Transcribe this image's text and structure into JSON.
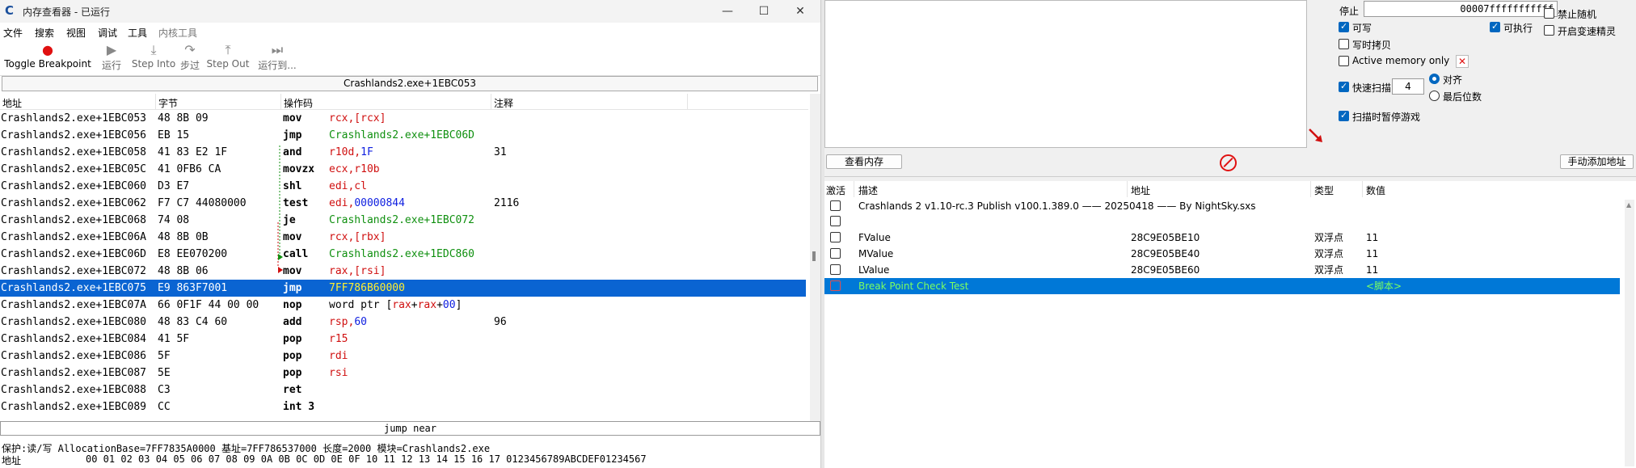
{
  "window": {
    "title": "内存查看器 - 已运行",
    "logo": "C",
    "min": "—",
    "max": "☐",
    "close": "✕"
  },
  "menu": [
    "文件",
    "搜索",
    "视图",
    "调试",
    "工具",
    "内核工具"
  ],
  "toolbar": [
    {
      "label": "Toggle Breakpoint",
      "icon": "●",
      "icon_name": "breakpoint-icon"
    },
    {
      "label": "运行",
      "icon": "▶",
      "icon_name": "run-icon"
    },
    {
      "label": "Step Into",
      "icon": "⤓",
      "icon_name": "step-into-icon"
    },
    {
      "label": "步过",
      "icon": "↷",
      "icon_name": "step-over-icon"
    },
    {
      "label": "Step Out",
      "icon": "⤒",
      "icon_name": "step-out-icon"
    },
    {
      "label": "运行到...",
      "icon": "⏭",
      "icon_name": "run-to-icon"
    }
  ],
  "address_bar": "Crashlands2.exe+1EBC053",
  "disasm_headers": {
    "addr": "地址",
    "bytes": "字节",
    "opcode": "操作码",
    "comment": "注释"
  },
  "disasm_rows": [
    {
      "addr": "Crashlands2.exe+1EBC053",
      "bytes": "48 8B 09",
      "op": "mov",
      "args": [
        [
          "rcx,[rcx]",
          "red"
        ]
      ],
      "comment": ""
    },
    {
      "addr": "Crashlands2.exe+1EBC056",
      "bytes": "EB 15",
      "op": "jmp",
      "args": [
        [
          "Crashlands2.exe+1EBC06D",
          "grn"
        ]
      ],
      "comment": ""
    },
    {
      "addr": "Crashlands2.exe+1EBC058",
      "bytes": "41 83 E2 1F",
      "op": "and",
      "args": [
        [
          "r10d,",
          "red"
        ],
        [
          "1F",
          "blu"
        ]
      ],
      "comment": "31"
    },
    {
      "addr": "Crashlands2.exe+1EBC05C",
      "bytes": "41 0FB6 CA",
      "op": "movzx",
      "args": [
        [
          "ecx,r10b",
          "red"
        ]
      ],
      "comment": ""
    },
    {
      "addr": "Crashlands2.exe+1EBC060",
      "bytes": "D3 E7",
      "op": "shl",
      "args": [
        [
          "edi,cl",
          "red"
        ]
      ],
      "comment": ""
    },
    {
      "addr": "Crashlands2.exe+1EBC062",
      "bytes": "F7 C7 44080000",
      "op": "test",
      "args": [
        [
          "edi,",
          "red"
        ],
        [
          "00000844",
          "blu"
        ]
      ],
      "comment": "2116"
    },
    {
      "addr": "Crashlands2.exe+1EBC068",
      "bytes": "74 08",
      "op": "je",
      "args": [
        [
          "Crashlands2.exe+1EBC072",
          "grn"
        ]
      ],
      "comment": ""
    },
    {
      "addr": "Crashlands2.exe+1EBC06A",
      "bytes": "48 8B 0B",
      "op": "mov",
      "args": [
        [
          "rcx,[rbx]",
          "red"
        ]
      ],
      "comment": ""
    },
    {
      "addr": "Crashlands2.exe+1EBC06D",
      "bytes": "E8 EE070200",
      "op": "call",
      "args": [
        [
          "Crashlands2.exe+1EDC860",
          "grn"
        ]
      ],
      "comment": ""
    },
    {
      "addr": "Crashlands2.exe+1EBC072",
      "bytes": "48 8B 06",
      "op": "mov",
      "args": [
        [
          "rax,[rsi]",
          "red"
        ]
      ],
      "comment": ""
    },
    {
      "addr": "Crashlands2.exe+1EBC075",
      "bytes": "E9 863F7001",
      "op": "jmp",
      "args": [
        [
          "7FF786B60000",
          "grn"
        ]
      ],
      "comment": "",
      "selected": true
    },
    {
      "addr": "Crashlands2.exe+1EBC07A",
      "bytes": "66 0F1F 44 00 00",
      "op": "nop",
      "args": [
        [
          "word ptr [",
          "plain"
        ],
        [
          "rax",
          "red"
        ],
        [
          "+",
          "plain"
        ],
        [
          "rax",
          "red"
        ],
        [
          "+",
          "plain"
        ],
        [
          "00",
          "blu"
        ],
        [
          "]",
          "plain"
        ]
      ],
      "comment": ""
    },
    {
      "addr": "Crashlands2.exe+1EBC080",
      "bytes": "48 83 C4 60",
      "op": "add",
      "args": [
        [
          "rsp,",
          "red"
        ],
        [
          "60",
          "blu"
        ]
      ],
      "comment": "96"
    },
    {
      "addr": "Crashlands2.exe+1EBC084",
      "bytes": "41 5F",
      "op": "pop",
      "args": [
        [
          "r15",
          "red"
        ]
      ],
      "comment": ""
    },
    {
      "addr": "Crashlands2.exe+1EBC086",
      "bytes": "5F",
      "op": "pop",
      "args": [
        [
          "rdi",
          "red"
        ]
      ],
      "comment": ""
    },
    {
      "addr": "Crashlands2.exe+1EBC087",
      "bytes": "5E",
      "op": "pop",
      "args": [
        [
          "rsi",
          "red"
        ]
      ],
      "comment": ""
    },
    {
      "addr": "Crashlands2.exe+1EBC088",
      "bytes": "C3",
      "op": "ret",
      "args": [],
      "comment": ""
    },
    {
      "addr": "Crashlands2.exe+1EBC089",
      "bytes": "CC",
      "op": "int 3",
      "args": [],
      "comment": ""
    }
  ],
  "jump_bar": "jump near",
  "protect_line": "保护:读/写  AllocationBase=7FF7835A0000 基址=7FF786537000 长度=2000 模块=Crashlands2.exe",
  "hex_line": {
    "label": "地址",
    "text": "00 01 02 03 04 05 06 07 08 09 0A 0B 0C 0D 0E 0F 10 11 12 13 14 15 16 17 0123456789ABCDEF01234567"
  },
  "scan_options": {
    "stop_label": "停止",
    "stop_value": "00007fffffffffff",
    "writable": "可写",
    "executable": "可执行",
    "copy_on_write": "写时拷贝",
    "active_memory": "Active memory only",
    "fast_scan": "快速扫描",
    "fast_scan_value": "4",
    "align": "对齐",
    "last_digits": "最后位数",
    "pause_game": "扫描时暂停游戏",
    "no_random": "禁止随机",
    "speedhack": "开启变速精灵"
  },
  "buttons": {
    "view_memory": "查看内存",
    "add_address": "手动添加地址"
  },
  "list_headers": {
    "active": "激活",
    "desc": "描述",
    "addr": "地址",
    "type": "类型",
    "value": "数值"
  },
  "list_rows": [
    {
      "desc": "Crashlands 2 v1.10-rc.3 Publish v100.1.389.0 —— 20250418 —— By NightSky.sxs",
      "addr": "",
      "type": "",
      "value": ""
    },
    {
      "desc": "",
      "addr": "",
      "type": "",
      "value": ""
    },
    {
      "desc": "FValue",
      "addr": "28C9E05BE10",
      "type": "双浮点",
      "value": "11"
    },
    {
      "desc": "MValue",
      "addr": "28C9E05BE40",
      "type": "双浮点",
      "value": "11"
    },
    {
      "desc": "LValue",
      "addr": "28C9E05BE60",
      "type": "双浮点",
      "value": "11"
    },
    {
      "desc": "Break Point Check Test",
      "addr": "",
      "type": "",
      "value": "<脚本>",
      "selected": true
    }
  ],
  "colors": {
    "selection": "#0a64d2",
    "red": "#d01010",
    "green": "#109010",
    "blue": "#1020e0"
  }
}
